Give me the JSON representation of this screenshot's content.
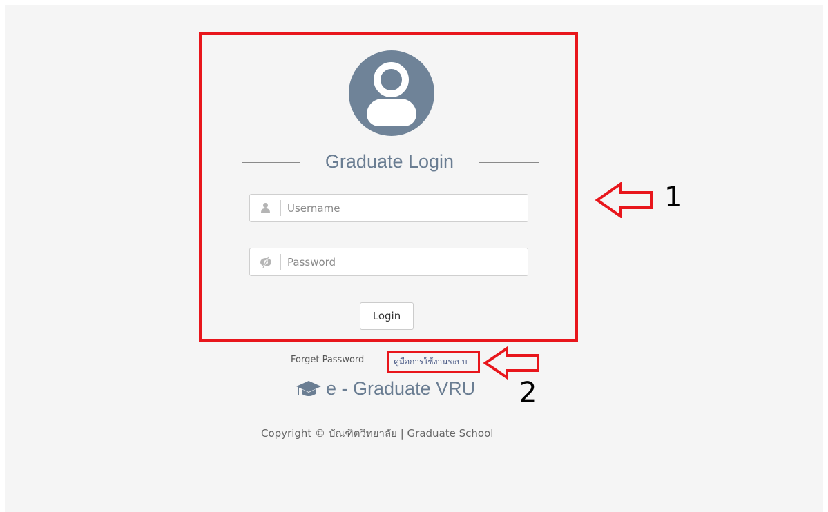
{
  "login_box": {
    "title": "Graduate Login",
    "username": {
      "placeholder": "Username",
      "value": ""
    },
    "password": {
      "placeholder": "Password",
      "value": ""
    },
    "login_label": "Login"
  },
  "links": {
    "forget_password": "Forget Password",
    "manual": "คู่มือการใช้งานระบบ"
  },
  "brand": {
    "name": "e - Graduate VRU"
  },
  "footer": {
    "copyright": "Copyright © บัณฑิตวิทยาลัย | Graduate School"
  },
  "annotations": {
    "marker_1": "1",
    "marker_2": "2"
  },
  "colors": {
    "highlight": "#e8161c",
    "accent": "#6a7d92",
    "avatar": "#6f8398"
  },
  "icons": [
    "user-avatar-icon",
    "user-icon",
    "eye-slash-icon",
    "graduation-cap-icon",
    "arrow-left-icon"
  ]
}
